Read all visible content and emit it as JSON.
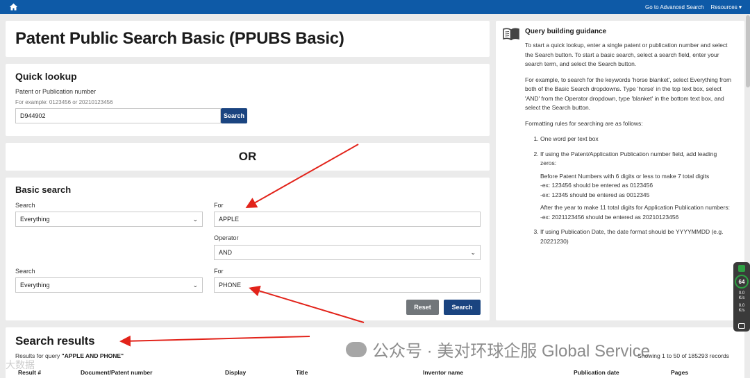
{
  "topbar": {
    "advanced_search": "Go to Advanced Search",
    "resources": "Resources",
    "resources_caret": "▾"
  },
  "page": {
    "title": "Patent Public Search Basic (PPUBS Basic)"
  },
  "quick_lookup": {
    "heading": "Quick lookup",
    "label": "Patent or Publication number",
    "hint": "For example: 0123456 or 20210123456",
    "value": "D944902",
    "button": "Search"
  },
  "or_text": "OR",
  "basic_search": {
    "heading": "Basic search",
    "row1": {
      "search_label": "Search",
      "search_value": "Everything",
      "for_label": "For",
      "for_value": "APPLE"
    },
    "operator": {
      "label": "Operator",
      "value": "AND"
    },
    "row2": {
      "search_label": "Search",
      "search_value": "Everything",
      "for_label": "For",
      "for_value": "PHONE"
    },
    "reset_button": "Reset",
    "search_button": "Search"
  },
  "guidance": {
    "heading": "Query building guidance",
    "p1": "To start a quick lookup, enter a single patent or publication number and select the Search button. To start a basic search, select a search field, enter your search term, and select the Search button.",
    "p2": "For example, to search for the keywords 'horse blanket', select Everything from both of the Basic Search dropdowns. Type 'horse' in the top text box, select 'AND' from the Operator dropdown, type 'blanket' in the bottom text box, and select the Search button.",
    "p3": "Formatting rules for searching are as follows:",
    "rule1": "One word per text box",
    "rule2": "If using the Patent/Application Publication number field, add leading zeros:",
    "rule2_a": "Before Patent Numbers with 6 digits or less to make 7 total digits",
    "rule2_a1": "-ex: 123456 should be entered as 0123456",
    "rule2_a2": "-ex: 12345 should be entered as 0012345",
    "rule2_b": "After the year to make 11 total digits for Application Publication numbers:",
    "rule2_b1": "-ex: 2021123456 should be entered as 20210123456",
    "rule3": "If using Publication Date, the date format should be YYYYMMDD (e.g. 20221230)"
  },
  "results": {
    "heading": "Search results",
    "query_prefix": "Results for query",
    "query": "\"APPLE AND PHONE\"",
    "count": "Showing 1 to 50 of 185293 records",
    "columns": [
      "Result #",
      "Document/Patent number",
      "Display",
      "Title",
      "Inventor name",
      "Publication date",
      "Pages"
    ]
  },
  "widget": {
    "gauge": "64",
    "stat1": "0.0",
    "stat1_unit": "K/s",
    "stat2": "0.0",
    "stat2_unit": "K/s"
  },
  "watermark": {
    "text": "公众号 · 美对环球企服 Global Service",
    "corner": "大数据"
  },
  "colors": {
    "topbar": "#0e5aa7",
    "primary_button": "#1a4480",
    "reset_button": "#71767a",
    "annotation_arrow": "#e2231a"
  }
}
